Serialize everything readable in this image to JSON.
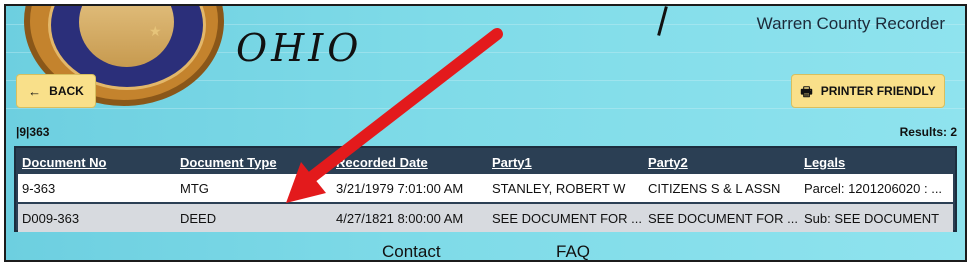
{
  "header": {
    "title": "Warren County Recorder",
    "ohio_text": "OHIO"
  },
  "toolbar": {
    "back_label": "BACK",
    "back_icon": "arrow-left-icon",
    "printer_label": "PRINTER FRIENDLY",
    "printer_icon": "printer-icon"
  },
  "results": {
    "query": "|9|363",
    "count_text": "Results: 2"
  },
  "table": {
    "columns": [
      "Document No",
      "Document Type",
      "Recorded Date",
      "Party1",
      "Party2",
      "Legals"
    ],
    "rows": [
      {
        "document_no": "9-363",
        "document_type": "MTG",
        "recorded_date": "3/21/1979 7:01:00 AM",
        "party1": "STANLEY, ROBERT W",
        "party2": "CITIZENS S & L ASSN",
        "legals": "Parcel: 1201206020 : ..."
      },
      {
        "document_no": "D009-363",
        "document_type": "DEED",
        "recorded_date": "4/27/1821 8:00:00 AM",
        "party1": "SEE DOCUMENT FOR ...",
        "party2": "SEE DOCUMENT FOR ...",
        "legals": "Sub: SEE DOCUMENT"
      }
    ]
  },
  "footer": {
    "contact": "Contact",
    "faq": "FAQ"
  },
  "colors": {
    "header_gradient_left": "#6dcfe0",
    "header_gradient_right": "#8fe3ee",
    "button_bg": "#f9e08a",
    "table_header_bg": "#2b3f54",
    "annotation_arrow": "#e31a1c"
  }
}
